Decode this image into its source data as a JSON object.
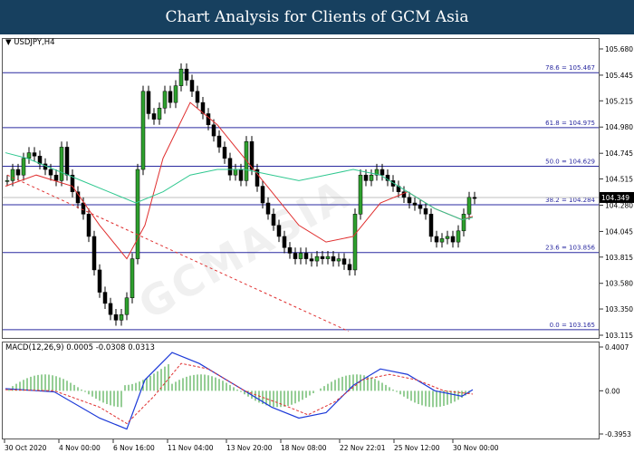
{
  "header": {
    "title": "Chart Analysis for Clients of GCM Asia"
  },
  "chart": {
    "symbol": "USDJPY,H4",
    "current_price": "104.349",
    "macd_label": "MACD(12,26,9) 0.0005 -0.0308 0.0313",
    "watermark": "GCMASIA",
    "colors": {
      "header_bg": "#17405f",
      "fib_line": "#2a2aa0",
      "ma_red": "#e03030",
      "ma_green": "#30c890",
      "macd_hist": "#2e9e2e",
      "macd_blue": "#1d3ad8",
      "macd_signal": "#e03030"
    }
  },
  "chart_data": {
    "type": "candlestick",
    "price_axis": [
      "105.680",
      "105.445",
      "105.215",
      "104.980",
      "104.745",
      "104.515",
      "104.280",
      "104.045",
      "103.815",
      "103.580",
      "103.350",
      "103.115"
    ],
    "time_axis": [
      "30 Oct 2020",
      "4 Nov 00:00",
      "6 Nov 16:00",
      "11 Nov 04:00",
      "13 Nov 20:00",
      "18 Nov 08:00",
      "22 Nov 22:01",
      "25 Nov 12:00",
      "30 Nov 00:00"
    ],
    "fib_levels": [
      {
        "label": "78.6 = 105.467",
        "value": 105.467
      },
      {
        "label": "61.8 = 104.975",
        "value": 104.975
      },
      {
        "label": "50.0 = 104.629",
        "value": 104.629
      },
      {
        "label": "38.2 = 104.284",
        "value": 104.284
      },
      {
        "label": "23.6 = 103.856",
        "value": 103.856
      },
      {
        "label": "0.0 = 103.165",
        "value": 103.165
      }
    ],
    "macd_axis": [
      "0.4007",
      "0.00",
      "-0.3953"
    ],
    "price_range": [
      103.115,
      105.68
    ],
    "macd_range": [
      -0.3953,
      0.4007
    ]
  }
}
